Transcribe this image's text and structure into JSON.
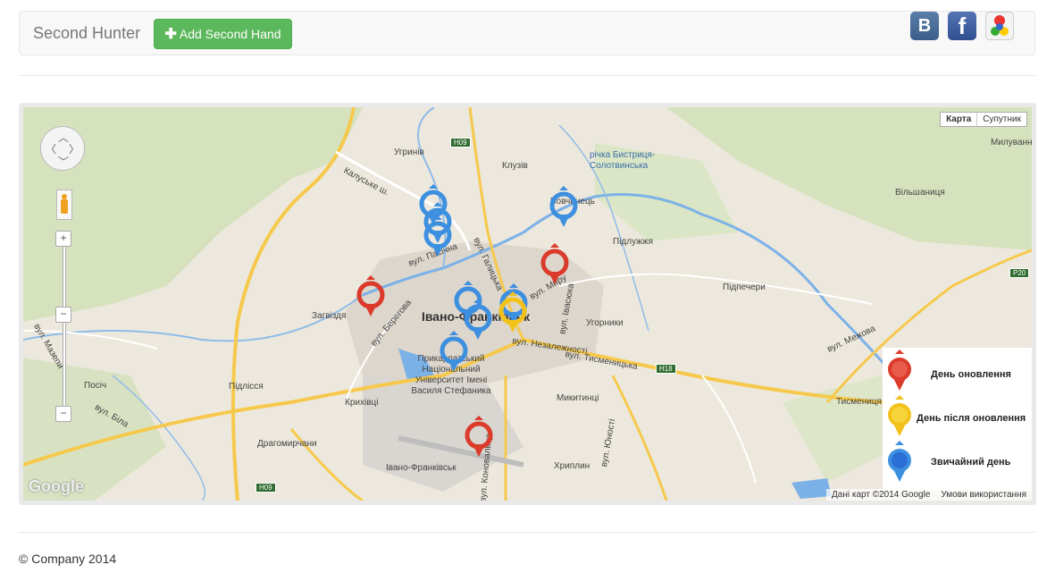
{
  "header": {
    "brand": "Second Hunter",
    "add_button_label": "Add Second Hand",
    "social": [
      {
        "name": "vk",
        "glyph": "B"
      },
      {
        "name": "facebook",
        "glyph": "f"
      },
      {
        "name": "google",
        "glyph": "g"
      }
    ]
  },
  "map": {
    "map_type_buttons": [
      "Карта",
      "Супутник"
    ],
    "zoom_in": "+",
    "zoom_out": "−",
    "google_logo": "Google",
    "attribution": "Дані карт ©2014 Google",
    "terms": "Умови використання",
    "places": {
      "uhryniv": "Угринів",
      "kluziv": "Клузів",
      "vovchynets": "Вовчинець",
      "pidluzhzhia": "Підлужжя",
      "milyvann": "Милуванн",
      "vilshanytsia": "Вільшаниця",
      "pidpechery": "Підпечери",
      "zahvizdia": "Загвіздя",
      "ivano_frankivsk": "Івано-Франківськ",
      "uhornyky": "Угорники",
      "university": "Прикарпатський Національний Університет Імені Василя Стефаника",
      "posich": "Посіч",
      "pidlissia": "Підлісся",
      "krykhivtsi": "Крихівці",
      "mykytyntsi": "Микитинці",
      "tysmenytsia": "Тисмениця",
      "drahomyrchany": "Драгомирчани",
      "ivano_frankivsk_airport": "Івано-Франківськ",
      "khryplyn": "Хриплин",
      "river": "річка Бистриця-Солотвинська",
      "kaluska": "Калуське ш.",
      "nezalezhnosti": "вул. Незалежності",
      "tysmenytska": "вул. Тисменицька",
      "myru": "вул. Миру",
      "vasoska": "вул. Івасюка",
      "halytska": "вул. Галицька",
      "berehova": "вул. Берегова",
      "bila": "вул. Біла",
      "yunosti": "вул. Юності",
      "konovaltsia": "вул. Коновальця",
      "mazepy": "вул. Мазепи",
      "mezhova": "вул. Межова",
      "pasichna": "вул. Пасічна"
    },
    "roads": [
      "H09",
      "H18",
      "P20",
      "H09"
    ],
    "colors": {
      "red": "#db3b2b",
      "yellow": "#f2c21b",
      "blue": "#3d8fe0"
    }
  },
  "legend": [
    {
      "label": "День оновлення",
      "color": "red"
    },
    {
      "label": "День після оновлення",
      "color": "yellow"
    },
    {
      "label": "Звичайний день",
      "color": "blue"
    }
  ],
  "footer": "© Company 2014"
}
